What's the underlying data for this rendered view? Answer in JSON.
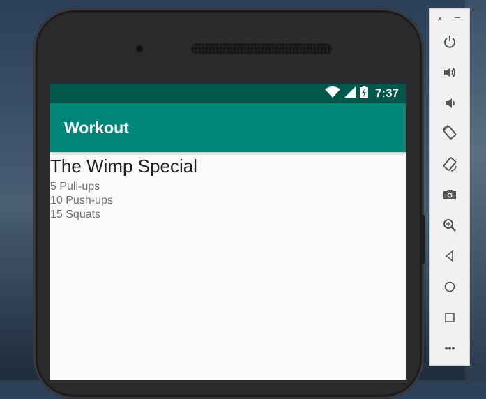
{
  "status_bar": {
    "time": "7:37",
    "icons": [
      "wifi-icon",
      "cell-signal-icon",
      "battery-charging-icon"
    ]
  },
  "app_bar": {
    "title": "Workout"
  },
  "workout": {
    "title": "The Wimp Special",
    "description": [
      "5 Pull-ups",
      "10 Push-ups",
      "15 Squats"
    ]
  },
  "emulator_toolbar": {
    "window_controls": {
      "close": "×",
      "minimize": "–"
    },
    "buttons": [
      "power-icon",
      "volume-up-icon",
      "volume-down-icon",
      "rotate-left-icon",
      "rotate-right-icon",
      "camera-icon",
      "zoom-icon",
      "back-icon",
      "home-icon",
      "overview-icon",
      "more-icon"
    ],
    "more_label": "•••"
  },
  "colors": {
    "status_bar": "#00574b",
    "app_bar": "#008577",
    "toolbar_icon": "#555555"
  }
}
